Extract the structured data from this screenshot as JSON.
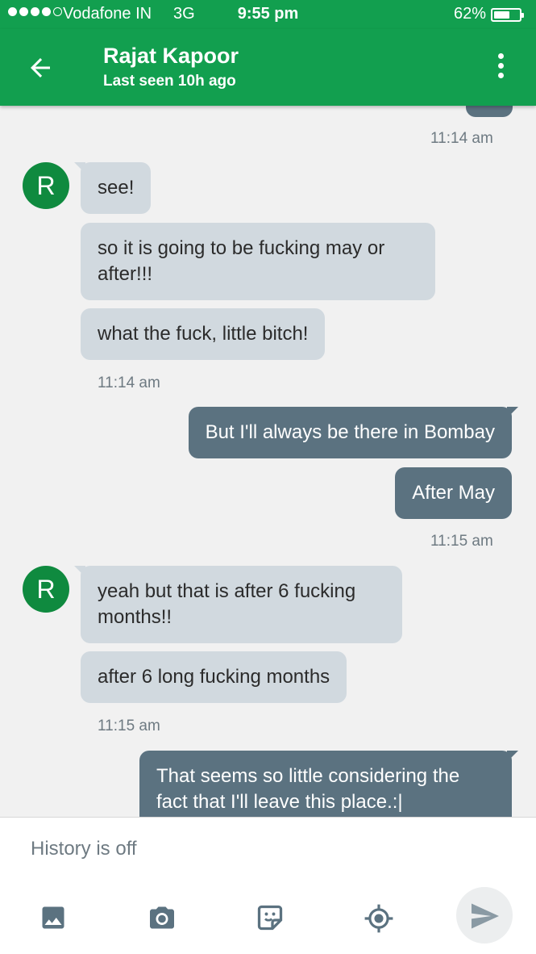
{
  "status_bar": {
    "carrier": "Vodafone IN",
    "network": "3G",
    "time": "9:55 pm",
    "battery_percent": "62%",
    "battery_level": 0.62
  },
  "header": {
    "contact_name": "Rajat Kapoor",
    "last_seen": "Last seen 10h ago",
    "back_icon": "arrow-back-icon",
    "menu_icon": "more-vert-icon"
  },
  "messages": [
    {
      "timestamp": "11:14 am"
    },
    {
      "avatar": "R",
      "bubbles": [
        "see!",
        "so it is going to be fucking may or after!!!",
        "what the fuck, little bitch!"
      ],
      "timestamp": "11:14 am"
    },
    {
      "bubbles": [
        "But I'll always be there in Bombay",
        "After May"
      ],
      "timestamp": "11:15 am"
    },
    {
      "avatar": "R",
      "bubbles": [
        "yeah but that is after 6 fucking months!!",
        "after 6 long fucking months"
      ],
      "timestamp": "11:15 am"
    },
    {
      "bubbles": [
        "That seems so little considering the fact that I'll leave this place.:|"
      ]
    }
  ],
  "composer": {
    "placeholder": "History is off",
    "icons": [
      "image-icon",
      "camera-icon",
      "sticker-icon",
      "location-icon",
      "send-icon"
    ]
  },
  "colors": {
    "primary": "#129f4f",
    "incoming_bubble": "#d1d9df",
    "outgoing_bubble": "#5b7280",
    "avatar": "#0f8a3f"
  }
}
